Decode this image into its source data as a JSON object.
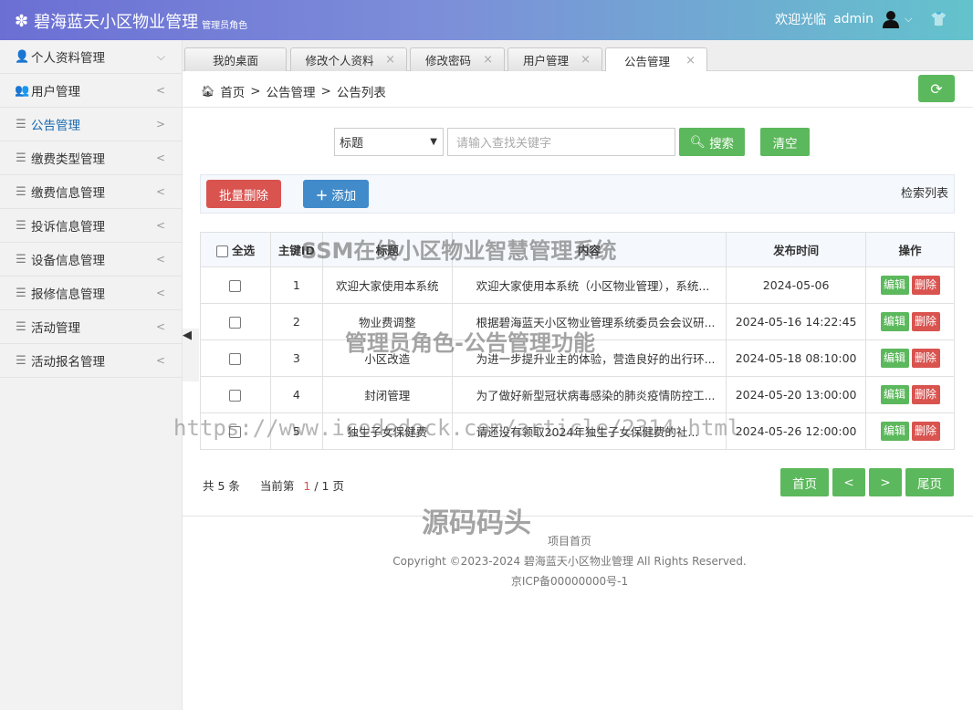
{
  "header": {
    "title": "碧海蓝天小区物业管理",
    "role": "管理员角色",
    "welcome": "欢迎光临",
    "username": "admin"
  },
  "sidebar": {
    "items": [
      {
        "label": "个人资料管理",
        "icon": "user-icon",
        "arrow": "⌵"
      },
      {
        "label": "用户管理",
        "icon": "users-icon",
        "arrow": "<"
      },
      {
        "label": "公告管理",
        "icon": "list-icon",
        "arrow": ">"
      },
      {
        "label": "缴费类型管理",
        "icon": "list-icon",
        "arrow": "<"
      },
      {
        "label": "缴费信息管理",
        "icon": "list-icon",
        "arrow": "<"
      },
      {
        "label": "投诉信息管理",
        "icon": "list-icon",
        "arrow": "<"
      },
      {
        "label": "设备信息管理",
        "icon": "list-icon",
        "arrow": "<"
      },
      {
        "label": "报修信息管理",
        "icon": "list-icon",
        "arrow": "<"
      },
      {
        "label": "活动管理",
        "icon": "list-icon",
        "arrow": "<"
      },
      {
        "label": "活动报名管理",
        "icon": "list-icon",
        "arrow": "<"
      }
    ]
  },
  "tabs": [
    {
      "label": "我的桌面"
    },
    {
      "label": "修改个人资料"
    },
    {
      "label": "修改密码"
    },
    {
      "label": "用户管理"
    },
    {
      "label": "公告管理"
    }
  ],
  "breadcrumb": {
    "home": "首页",
    "section": "公告管理",
    "page": "公告列表"
  },
  "search": {
    "field_selected": "标题",
    "placeholder": "请输入查找关键字",
    "search_label": "搜索",
    "clear_label": "清空"
  },
  "toolbar": {
    "batch_delete": "批量删除",
    "add": "添加",
    "retrieve_list": "检索列表"
  },
  "table": {
    "headers": {
      "select_all": "全选",
      "id": "主键ID",
      "title": "标题",
      "content": "内容",
      "time": "发布时间",
      "ops": "操作"
    },
    "rows": [
      {
        "id": "1",
        "title": "欢迎大家使用本系统",
        "content": "欢迎大家使用本系统（小区物业管理），系统...",
        "time": "2024-05-06"
      },
      {
        "id": "2",
        "title": "物业费调整",
        "content": "根据碧海蓝天小区物业管理系统委员会会议研...",
        "time": "2024-05-16 14:22:45"
      },
      {
        "id": "3",
        "title": "小区改造",
        "content": "为进一步提升业主的体验，营造良好的出行环...",
        "time": "2024-05-18 08:10:00"
      },
      {
        "id": "4",
        "title": "封闭管理",
        "content": "为了做好新型冠状病毒感染的肺炎疫情防控工...",
        "time": "2024-05-20 13:00:00"
      },
      {
        "id": "5",
        "title": "独生子女保健费",
        "content": "请还没有领取2024年独生子女保健费的社...",
        "time": "2024-05-26 12:00:00"
      }
    ],
    "edit_label": "编辑",
    "delete_label": "删除"
  },
  "pagination": {
    "total": "共 5 条",
    "current_prefix": "当前第",
    "current": "1",
    "current_suffix": "/ 1 页",
    "first": "首页",
    "prev": "<",
    "next": ">",
    "last": "尾页"
  },
  "footer": {
    "link": "项目首页",
    "copyright": "Copyright ©2023-2024 碧海蓝天小区物业管理 All Rights Reserved.",
    "icp": "京ICP备00000000号-1"
  },
  "watermarks": {
    "w1": "SSM在线小区物业智慧管理系统",
    "w2": "管理员角色-公告管理功能",
    "w3": "https://www.icodedock.com/article/2314.html",
    "w4": "源码码头"
  },
  "colors": {
    "green": "#5cb85c",
    "red": "#d9534f",
    "blue": "#428bca",
    "active_link": "#1a6ab0"
  }
}
